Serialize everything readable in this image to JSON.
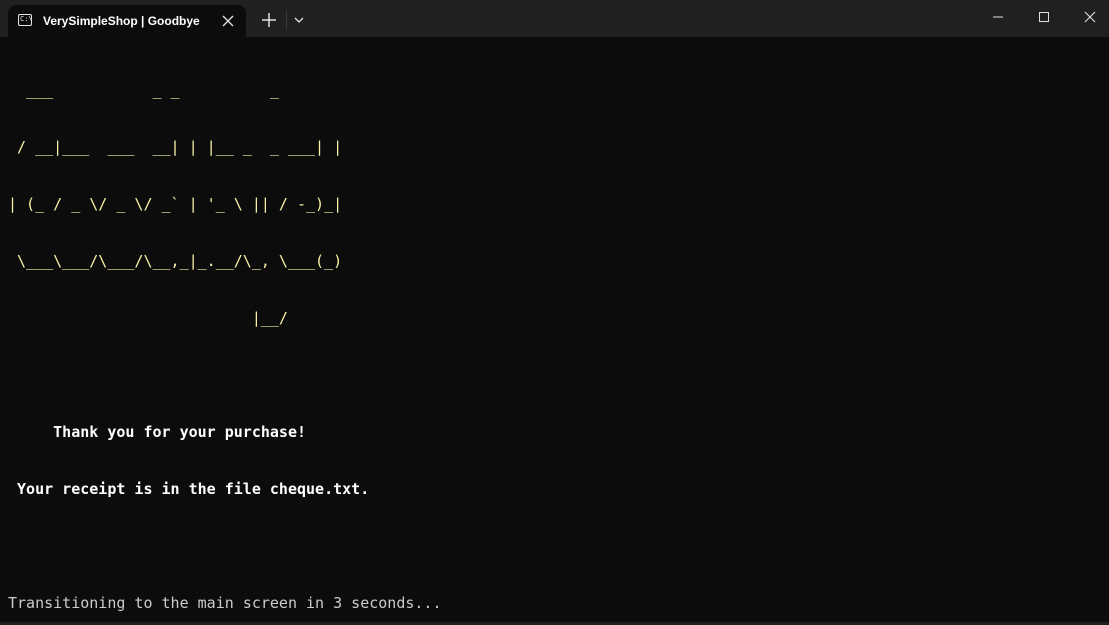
{
  "window": {
    "tab_title": "VerySimpleShop | Goodbye",
    "tab_icon_text": "C:\\",
    "icons": {
      "tab_icon": "terminal-icon",
      "tab_close": "close-icon",
      "new_tab": "plus-icon",
      "dropdown": "chevron-down-icon",
      "minimize": "minimize-icon",
      "maximize": "maximize-icon",
      "close": "close-icon"
    }
  },
  "terminal": {
    "ascii_art": [
      "  ___           _ _          _ ",
      " / __|___  ___  __| | |__ _  _ ___| |",
      "| (_ / _ \\/ _ \\/ _` | '_ \\ || / -_)_|",
      " \\___\\___/\\___/\\__,_|_.__/\\_, \\___(_)",
      "                           |__/"
    ],
    "message_lines": [
      "     Thank you for your purchase!",
      " Your receipt is in the file cheque.txt."
    ],
    "status_line": "Transitioning to the main screen in 3 seconds..."
  },
  "colors": {
    "background": "#0c0c0c",
    "titlebar": "#202020",
    "ascii_art": "#f9f1a5",
    "message": "#ffffff",
    "status": "#cccccc"
  }
}
